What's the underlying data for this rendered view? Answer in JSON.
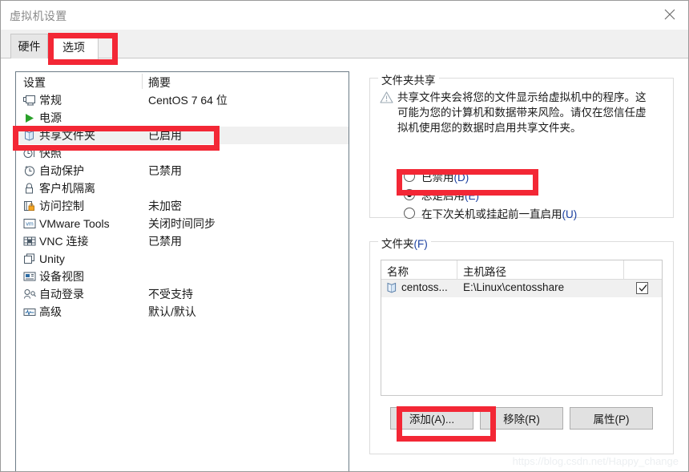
{
  "window": {
    "title": "虚拟机设置",
    "close_label": "×"
  },
  "tabs": [
    {
      "label": "硬件",
      "selected": false
    },
    {
      "label": "选项",
      "selected": true
    }
  ],
  "settings_list": {
    "headers": {
      "name": "设置",
      "summary": "摘要"
    },
    "rows": [
      {
        "icon": "monitor-icon",
        "label": "常规",
        "summary": "CentOS 7 64 位",
        "selected": false
      },
      {
        "icon": "power-play-icon",
        "label": "电源",
        "summary": "",
        "selected": false
      },
      {
        "icon": "shared-folder-icon",
        "label": "共享文件夹",
        "summary": "已启用",
        "selected": true
      },
      {
        "icon": "snapshot-icon",
        "label": "快照",
        "summary": "",
        "selected": false
      },
      {
        "icon": "autoprotect-icon",
        "label": "自动保护",
        "summary": "已禁用",
        "selected": false
      },
      {
        "icon": "lock-icon",
        "label": "客户机隔离",
        "summary": "",
        "selected": false
      },
      {
        "icon": "access-control-icon",
        "label": "访问控制",
        "summary": "未加密",
        "selected": false
      },
      {
        "icon": "vmware-tools-icon",
        "label": "VMware Tools",
        "summary": "关闭时间同步",
        "selected": false
      },
      {
        "icon": "vnc-icon",
        "label": "VNC 连接",
        "summary": "已禁用",
        "selected": false
      },
      {
        "icon": "unity-icon",
        "label": "Unity",
        "summary": "",
        "selected": false
      },
      {
        "icon": "device-view-icon",
        "label": "设备视图",
        "summary": "",
        "selected": false
      },
      {
        "icon": "auto-login-icon",
        "label": "自动登录",
        "summary": "不受支持",
        "selected": false
      },
      {
        "icon": "advanced-icon",
        "label": "高级",
        "summary": "默认/默认",
        "selected": false
      }
    ]
  },
  "folder_sharing": {
    "group_title": "文件夹共享",
    "warning_icon": "warning-triangle-icon",
    "warning_text": "共享文件夹会将您的文件显示给虚拟机中的程序。这可能为您的计算机和数据带来风险。请仅在您信任虚拟机使用您的数据时启用共享文件夹。",
    "options": [
      {
        "label": "已禁用",
        "accel": "(D)",
        "checked": false
      },
      {
        "label": "总是启用",
        "accel": "(E)",
        "checked": true
      },
      {
        "label": "在下次关机或挂起前一直启用",
        "accel": "(U)",
        "checked": false
      }
    ]
  },
  "folders": {
    "group_title": "文件夹",
    "group_accel": "(F)",
    "columns": [
      "名称",
      "主机路径",
      ""
    ],
    "rows": [
      {
        "icon": "shared-folder-icon",
        "name": "centoss...",
        "host_path": "E:\\Linux\\centosshare",
        "enabled": true
      }
    ],
    "buttons": [
      {
        "label": "添加(A)...",
        "name": "add"
      },
      {
        "label": "移除(R)",
        "name": "remove"
      },
      {
        "label": "属性(P)",
        "name": "properties"
      }
    ]
  },
  "annotations": {
    "color": "#f32735",
    "highlighted": [
      "选项 tab",
      "共享文件夹 row",
      "总是启用(E) radio",
      "添加(A)... button"
    ]
  },
  "watermark": {
    "text": "https://blog.csdn.net/Happy_change"
  }
}
